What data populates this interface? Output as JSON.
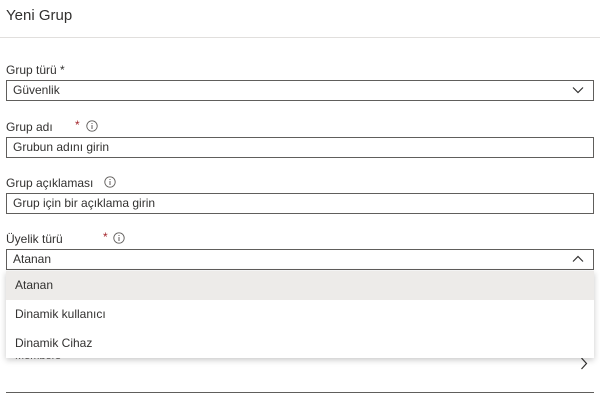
{
  "panel": {
    "title": "Yeni Grup"
  },
  "fields": {
    "group_type": {
      "label": "Grup türü *",
      "value": "Güvenlik"
    },
    "group_name": {
      "label": "Grup adı",
      "required_mark": "*",
      "value": "Grubun adını girin"
    },
    "group_description": {
      "label": "Grup açıklaması",
      "value": "Grup için bir açıklama girin"
    },
    "membership_type": {
      "label": "Üyelik türü",
      "required_mark": "*",
      "value": "Atanan",
      "options": [
        "Atanan",
        "Dinamik kullanıcı",
        "Dinamik Cihaz"
      ],
      "selected_index": 0
    }
  },
  "members": {
    "label": "Members"
  },
  "colors": {
    "required": "#a4262c",
    "border": "#605e5c",
    "selected_bg": "#edebe9",
    "divider": "#e1dfdd"
  },
  "icons": [
    "info-icon",
    "chevron-down-icon",
    "chevron-up-icon",
    "chevron-right-icon"
  ]
}
